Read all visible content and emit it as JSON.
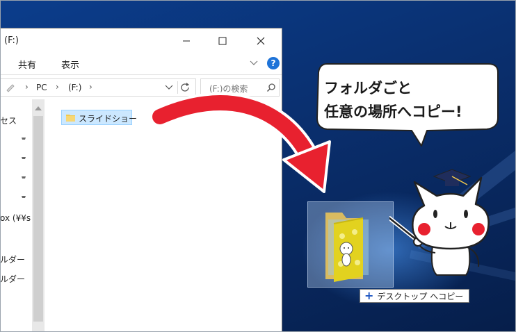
{
  "window": {
    "title": "(F:)",
    "controls": {
      "minimize": "—",
      "maximize": "☐",
      "close": "✕"
    }
  },
  "ribbon": {
    "tabs": [
      "共有",
      "表示"
    ],
    "help": "?"
  },
  "address": {
    "crumbs": [
      "PC",
      "(F:)"
    ],
    "search_placeholder": "(F:)の検索"
  },
  "nav": {
    "items": [
      "セス",
      "ox (¥¥s",
      "ルダー",
      "ルダー"
    ]
  },
  "content": {
    "files": [
      {
        "name": "スライドショー",
        "selected": true
      }
    ]
  },
  "drag": {
    "tooltip": "デスクトップ へコピー",
    "plus": "+"
  },
  "bubble": {
    "line1": "フォルダごと",
    "line2": "任意の場所へコピー!"
  },
  "colors": {
    "accent_red": "#e8212f",
    "selection": "#cce8ff",
    "desktop_blue": "#0a2f6e"
  }
}
